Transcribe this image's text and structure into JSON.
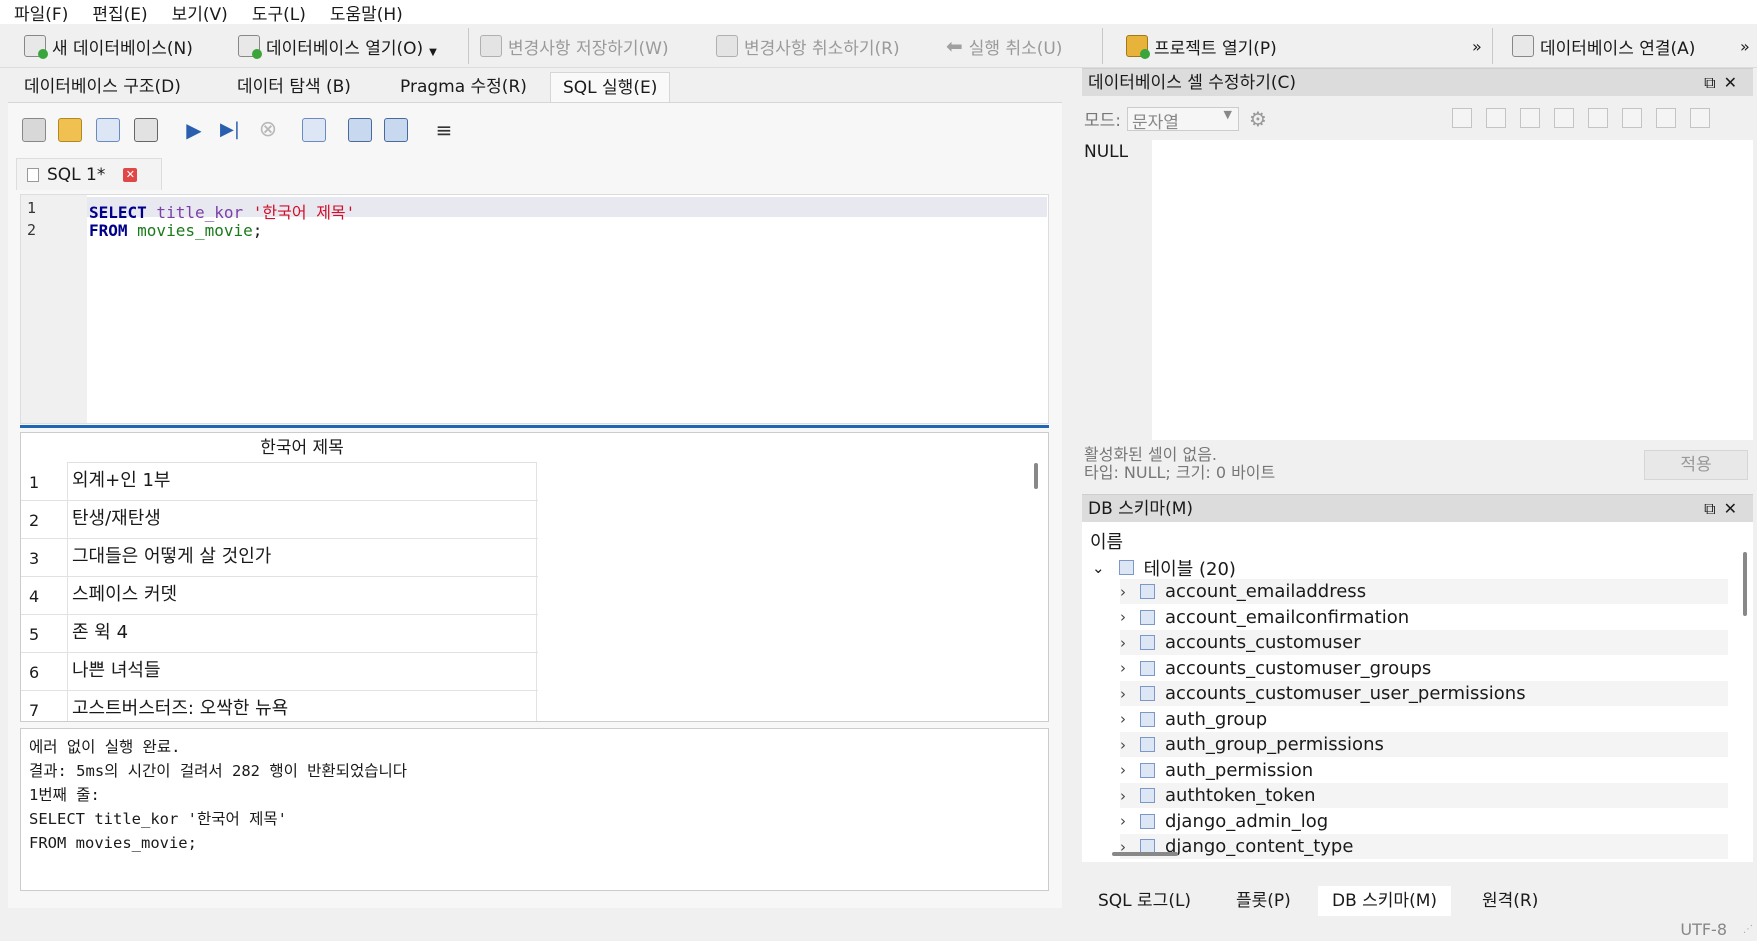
{
  "menu": [
    "파일(F)",
    "편집(E)",
    "보기(V)",
    "도구(L)",
    "도움말(H)"
  ],
  "toolbar": {
    "new_db": "새 데이터베이스(N)",
    "open_db": "데이터베이스 열기(O)",
    "write_changes": "변경사항 저장하기(W)",
    "revert_changes": "변경사항 취소하기(R)",
    "undo": "실행 취소(U)",
    "open_project": "프로젝트 열기(P)",
    "overflow": "»",
    "attach_db": "데이터베이스 연결(A)",
    "overflow2": "»"
  },
  "main_tabs": [
    "데이터베이스 구조(D)",
    "데이터 탐색 (B)",
    "Pragma 수정(R)",
    "SQL 실행(E)"
  ],
  "sql_tab": {
    "label": "SQL 1*"
  },
  "editor": {
    "line_numbers": [
      "1",
      "2"
    ],
    "line1": {
      "kw": "SELECT",
      "col": " title_kor ",
      "str": "'한국어 제목'"
    },
    "line2": {
      "kw": "FROM",
      "tbl": " movies_movie",
      "end": ";"
    }
  },
  "results": {
    "column": "한국어 제목",
    "rows": [
      {
        "n": "1",
        "v": "외계+인 1부"
      },
      {
        "n": "2",
        "v": "탄생/재탄생"
      },
      {
        "n": "3",
        "v": "그대들은 어떻게 살 것인가"
      },
      {
        "n": "4",
        "v": "스페이스 커뎃"
      },
      {
        "n": "5",
        "v": "존 윅 4"
      },
      {
        "n": "6",
        "v": "나쁜 녀석들"
      },
      {
        "n": "7",
        "v": "고스트버스터즈: 오싹한 뉴욕"
      }
    ]
  },
  "message": "에러 없이 실행 완료.\n결과: 5ms의 시간이 걸려서 282 행이 반환되었습니다\n1번째 줄:\nSELECT title_kor '한국어 제목'\nFROM movies_movie;",
  "cell_editor": {
    "title": "데이터베이스 셀 수정하기(C)",
    "mode_label": "모드:",
    "mode_value": "문자열",
    "value": "NULL",
    "status1": "활성화된 셀이 없음.",
    "status2": "타입: NULL; 크기: 0 바이트",
    "apply": "적용",
    "controls": "⧉✕"
  },
  "schema": {
    "title": "DB 스키마(M)",
    "header": "이름",
    "tables_label": "테이블 (20)",
    "tables": [
      "account_emailaddress",
      "account_emailconfirmation",
      "accounts_customuser",
      "accounts_customuser_groups",
      "accounts_customuser_user_permissions",
      "auth_group",
      "auth_group_permissions",
      "auth_permission",
      "authtoken_token",
      "django_admin_log",
      "django_content_type"
    ],
    "controls": "⧉✕"
  },
  "bottom_tabs": [
    "SQL 로그(L)",
    "플롯(P)",
    "DB 스키마(M)",
    "원격(R)"
  ],
  "status": {
    "encoding": "UTF-8"
  },
  "colors": {
    "accent": "#1f66b5",
    "keyword": "#00008b",
    "string": "#d0102a",
    "table": "#1a7a1a"
  }
}
